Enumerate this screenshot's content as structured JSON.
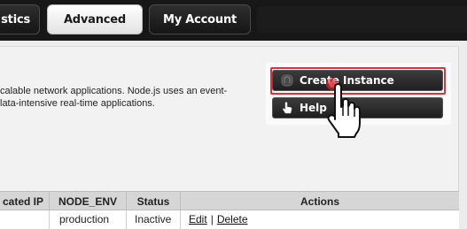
{
  "tabs": [
    {
      "label": "stics",
      "active": false
    },
    {
      "label": "Advanced",
      "active": true
    },
    {
      "label": "My Account",
      "active": false
    }
  ],
  "description": {
    "line1": "calable network applications. Node.js uses an event-",
    "line2": "lata-intensive real-time applications."
  },
  "buttons": {
    "create_label": "Create Instance",
    "help_label": "Help"
  },
  "icons": {
    "create": "app-icon",
    "help": "hand-pointer-icon",
    "cursor": "hand-pointer-cursor-icon"
  },
  "colors": {
    "focus_ring": "#d8323b",
    "tabbar": "#171717",
    "button": "#2b2b2b"
  },
  "table": {
    "headers": [
      "cated IP",
      "NODE_ENV",
      "Status",
      "Actions"
    ],
    "rows": [
      {
        "ip": "",
        "env": "production",
        "status": "Inactive",
        "edit": "Edit",
        "separator": "|",
        "delete": "Delete"
      }
    ]
  }
}
